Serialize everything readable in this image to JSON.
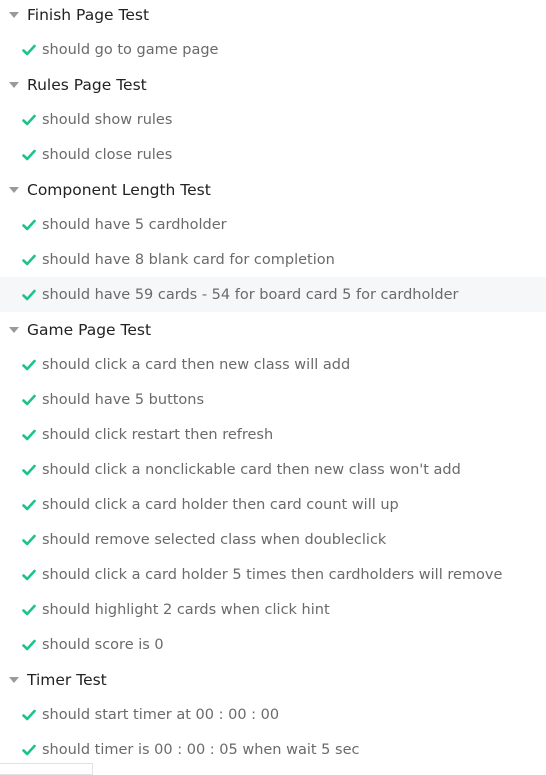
{
  "colors": {
    "pass": "#1cc48c",
    "suite_text": "#222222",
    "test_text": "#6a6a6a"
  },
  "suites": [
    {
      "title": "Finish Page Test",
      "tests": [
        "should go to game page"
      ]
    },
    {
      "title": "Rules Page Test",
      "tests": [
        "should show rules",
        "should close rules"
      ]
    },
    {
      "title": "Component Length Test",
      "tests": [
        "should have 5 cardholder",
        "should have 8 blank card for completion",
        "should have 59 cards - 54 for board card 5 for cardholder"
      ]
    },
    {
      "title": "Game Page Test",
      "tests": [
        "should click a card then new class will add",
        "should have 5 buttons",
        "should click restart then refresh",
        "should click a nonclickable card then new class won't add",
        "should click a card holder then card count will up",
        "should remove selected class when doubleclick",
        "should click a card holder 5 times then cardholders will remove",
        "should highlight 2 cards when click hint",
        "should score is 0"
      ]
    },
    {
      "title": "Timer Test",
      "tests": [
        "should start timer at 00 : 00 : 00",
        "should timer is 00 : 00 : 05 when wait 5 sec"
      ]
    }
  ],
  "hovered_test": "should have 59 cards - 54 for board card 5 for cardholder"
}
